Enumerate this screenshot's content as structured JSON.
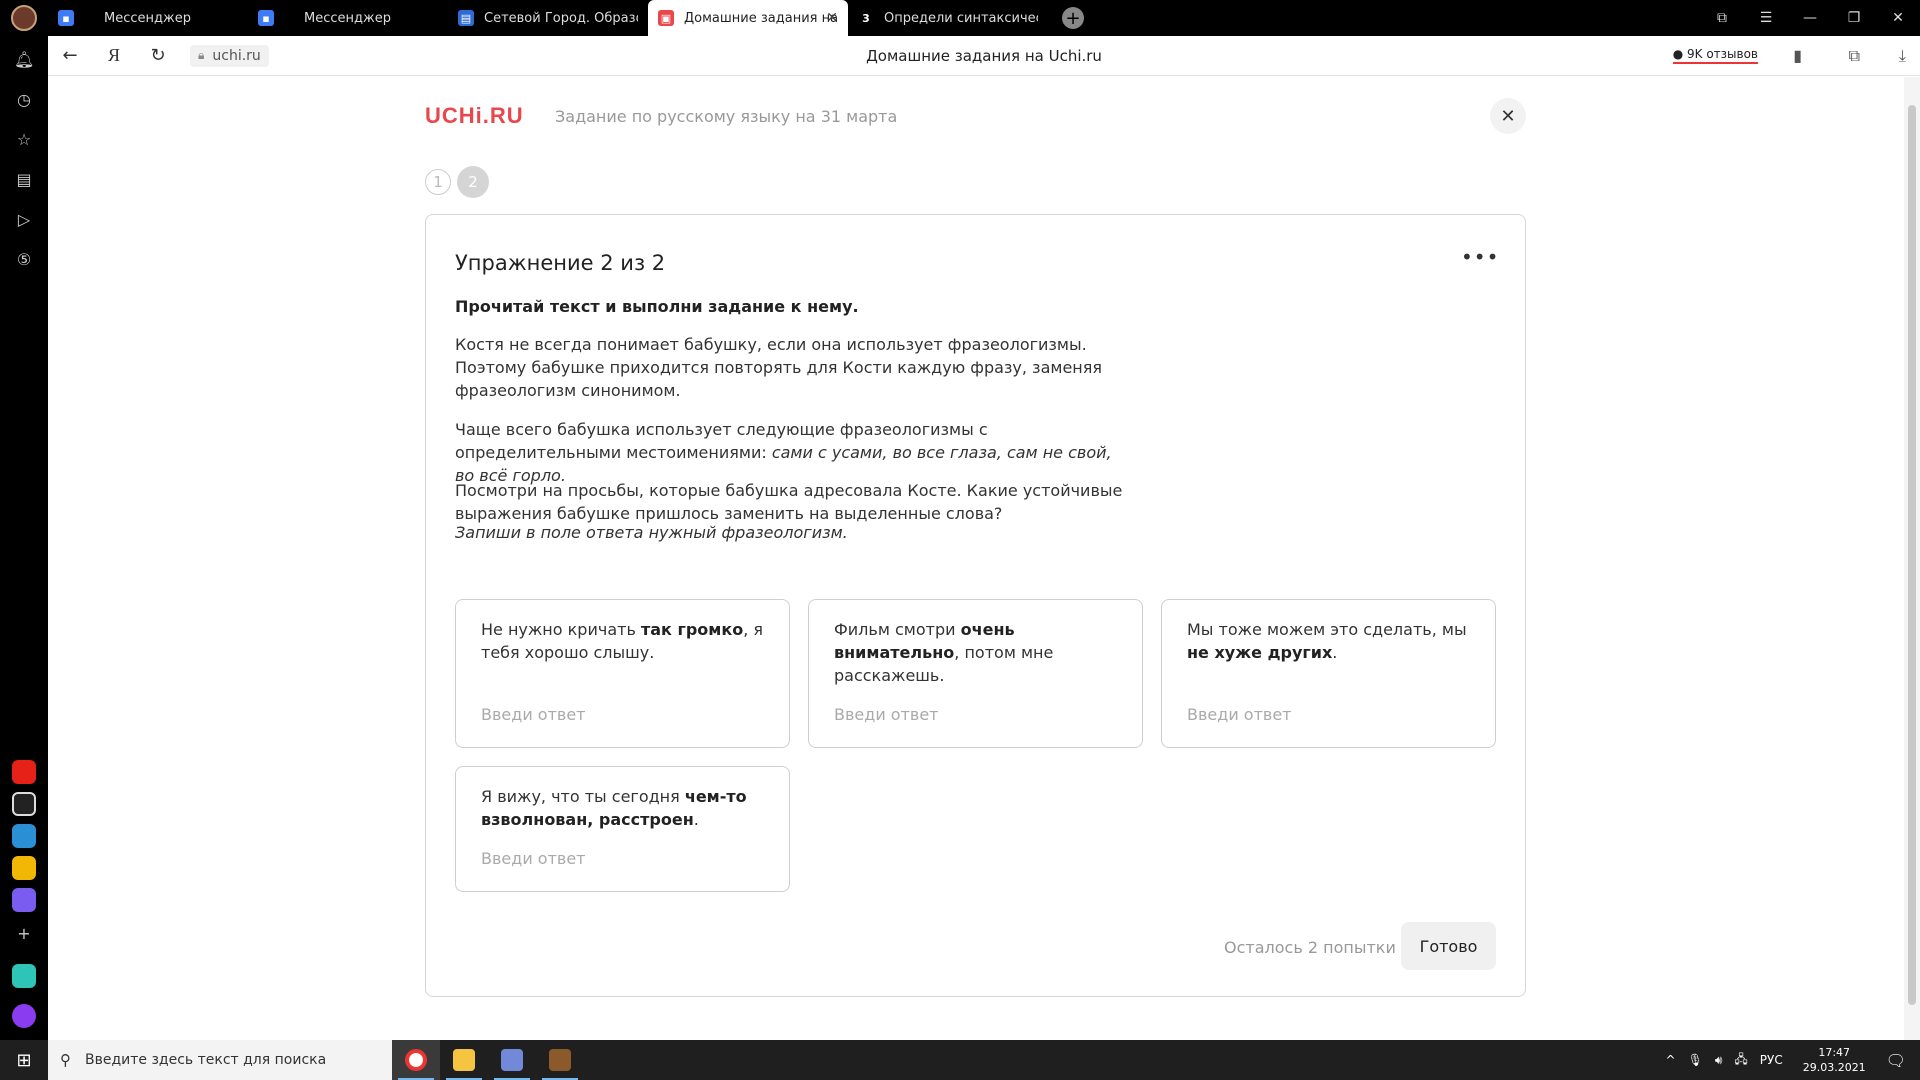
{
  "browser": {
    "tabs": [
      {
        "label": "Мессенджер",
        "icon": "chat-icon",
        "color": "#3d7cf5",
        "active": false
      },
      {
        "label": "Мессенджер",
        "icon": "chat-icon",
        "color": "#3d7cf5",
        "active": false
      },
      {
        "label": "Сетевой Город. Образова",
        "icon": "school-icon",
        "color": "#2f6bd6",
        "active": false
      },
      {
        "label": "Домашние задания на",
        "icon": "uchi-icon",
        "color": "#e8474c",
        "active": true
      },
      {
        "label": "Определи синтаксически",
        "icon": "3",
        "color": "#000000",
        "active": false
      }
    ],
    "url": "uchi.ru",
    "page_title": "Домашние задания на Uchi.ru",
    "reviews": "9K отзывов",
    "reviews_icon": "speech-bubble-icon"
  },
  "header": {
    "logo": "UCHi.RU",
    "task_title": "Задание по русскому языку на 31 марта",
    "steps": [
      "1",
      "2"
    ],
    "current_step": 2
  },
  "exercise": {
    "title": "Упражнение 2 из 2",
    "instruction": "Прочитай текст и выполни задание к нему.",
    "paragraph1": "Костя не всегда понимает бабушку, если она использует фразеологизмы. Поэтому бабушке приходится повторять для Кости каждую фразу, заменяя фразеологизм синонимом.",
    "paragraph2_prefix": "Чаще всего бабушка использует следующие фразеологизмы с определительными местоимениями: ",
    "paragraph2_italic": "сами с усами, во все глаза, сам не свой, во всё горло.",
    "paragraph3": "Посмотри на просьбы, которые бабушка адресовала Косте. Какие устойчивые выражения бабушке пришлось заменить на выделенные слова?",
    "hint": "Запиши в поле ответа нужный фразеологизм.",
    "cards": [
      {
        "before": "Не нужно кричать ",
        "bold": "так громко",
        "after": ", я тебя хорошо слышу.",
        "placeholder": "Введи ответ"
      },
      {
        "before": "Фильм смотри ",
        "bold": "очень внимательно",
        "after": ", потом мне расскажешь.",
        "placeholder": "Введи ответ"
      },
      {
        "before": "Мы тоже можем это сделать, мы ",
        "bold": "не хуже других",
        "after": ".",
        "placeholder": "Введи ответ"
      },
      {
        "before": "Я вижу, что ты сегодня ",
        "bold": "чем-то взволнован, расстроен",
        "after": ".",
        "placeholder": "Введи ответ"
      }
    ],
    "attempts": "Осталось 2 попытки",
    "done_label": "Готово"
  },
  "taskbar": {
    "search_placeholder": "Введите здесь текст для поиска",
    "language": "РУС",
    "time": "17:47",
    "date": "29.03.2021"
  },
  "colors": {
    "accent": "#e8474c",
    "muted": "#999999"
  }
}
